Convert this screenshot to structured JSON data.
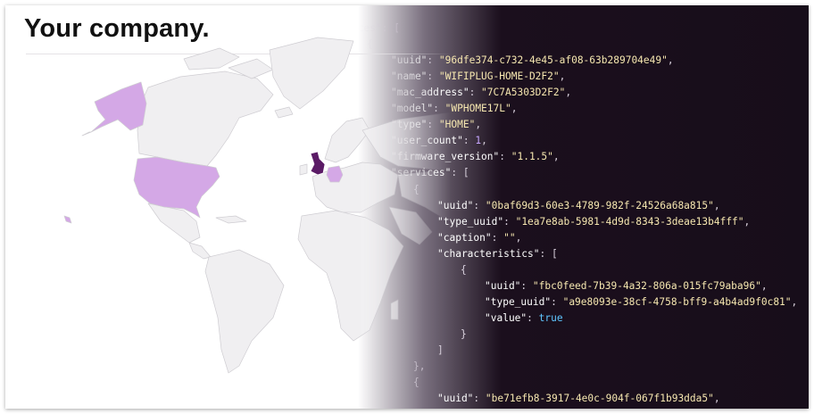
{
  "header": {
    "title": "Your company."
  },
  "colors": {
    "land": "#f0eff1",
    "land_stroke": "#cfcdd2",
    "highlight_light": "#d4a8e6",
    "highlight_dark": "#5b1b66",
    "code_background": "#170d1a"
  },
  "map": {
    "highlighted_regions": [
      {
        "region": "Alaska",
        "level": "light"
      },
      {
        "region": "United States",
        "level": "light"
      },
      {
        "region": "Hawaii",
        "level": "light"
      },
      {
        "region": "United Kingdom",
        "level": "dark"
      },
      {
        "region": "Germany",
        "level": "light"
      }
    ]
  },
  "code": {
    "lines": [
      [
        [
          "p",
          "ices\": ["
        ]
      ],
      [
        [
          "p",
          "{"
        ]
      ],
      [
        [
          "k",
          "\"uuid\""
        ],
        [
          "p",
          ": "
        ],
        [
          "s",
          "\"96dfe374-c732-4e45-af08-63b289704e49\""
        ],
        [
          "p",
          ","
        ]
      ],
      [
        [
          "k",
          "\"name\""
        ],
        [
          "p",
          ": "
        ],
        [
          "s",
          "\"WIFIPLUG-HOME-D2F2\""
        ],
        [
          "p",
          ","
        ]
      ],
      [
        [
          "k",
          "\"mac_address\""
        ],
        [
          "p",
          ": "
        ],
        [
          "s",
          "\"7C7A5303D2F2\""
        ],
        [
          "p",
          ","
        ]
      ],
      [
        [
          "k",
          "\"model\""
        ],
        [
          "p",
          ": "
        ],
        [
          "s",
          "\"WPHOME17L\""
        ],
        [
          "p",
          ","
        ]
      ],
      [
        [
          "k",
          "\"type\""
        ],
        [
          "p",
          ": "
        ],
        [
          "s",
          "\"HOME\""
        ],
        [
          "p",
          ","
        ]
      ],
      [
        [
          "k",
          "\"user_count\""
        ],
        [
          "p",
          ": "
        ],
        [
          "n",
          "1"
        ],
        [
          "p",
          ","
        ]
      ],
      [
        [
          "k",
          "\"firmware_version\""
        ],
        [
          "p",
          ": "
        ],
        [
          "s",
          "\"1.1.5\""
        ],
        [
          "p",
          ","
        ]
      ],
      [
        [
          "k",
          "\"services\""
        ],
        [
          "p",
          ": ["
        ]
      ],
      [
        [
          "p",
          "{"
        ]
      ],
      [
        [
          "k",
          "\"uuid\""
        ],
        [
          "p",
          ": "
        ],
        [
          "s",
          "\"0baf69d3-60e3-4789-982f-24526a68a815\""
        ],
        [
          "p",
          ","
        ]
      ],
      [
        [
          "k",
          "\"type_uuid\""
        ],
        [
          "p",
          ": "
        ],
        [
          "s",
          "\"1ea7e8ab-5981-4d9d-8343-3deae13b4fff\""
        ],
        [
          "p",
          ","
        ]
      ],
      [
        [
          "k",
          "\"caption\""
        ],
        [
          "p",
          ": "
        ],
        [
          "s",
          "\"\""
        ],
        [
          "p",
          ","
        ]
      ],
      [
        [
          "k",
          "\"characteristics\""
        ],
        [
          "p",
          ": ["
        ]
      ],
      [
        [
          "p",
          "{"
        ]
      ],
      [
        [
          "k",
          "\"uuid\""
        ],
        [
          "p",
          ": "
        ],
        [
          "s",
          "\"fbc0feed-7b39-4a32-806a-015fc79aba96\""
        ],
        [
          "p",
          ","
        ]
      ],
      [
        [
          "k",
          "\"type_uuid\""
        ],
        [
          "p",
          ": "
        ],
        [
          "s",
          "\"a9e8093e-38cf-4758-bff9-a4b4ad9f0c81\""
        ],
        [
          "p",
          ","
        ]
      ],
      [
        [
          "k",
          "\"value\""
        ],
        [
          "p",
          ": "
        ],
        [
          "b",
          "true"
        ]
      ],
      [
        [
          "p",
          "}"
        ]
      ],
      [
        [
          "p",
          "]"
        ]
      ],
      [
        [
          "p",
          "},"
        ]
      ],
      [
        [
          "p",
          "{"
        ]
      ],
      [
        [
          "k",
          "\"uuid\""
        ],
        [
          "p",
          ": "
        ],
        [
          "s",
          "\"be71efb8-3917-4e0c-904f-067f1b93dda5\""
        ],
        [
          "p",
          ","
        ]
      ]
    ]
  }
}
